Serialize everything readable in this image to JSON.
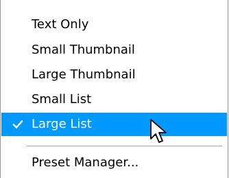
{
  "menu": {
    "items": [
      {
        "label": "Text Only",
        "checked": false
      },
      {
        "label": "Small Thumbnail",
        "checked": false
      },
      {
        "label": "Large Thumbnail",
        "checked": false
      },
      {
        "label": "Small List",
        "checked": false
      },
      {
        "label": "Large List",
        "checked": true,
        "highlighted": true
      }
    ],
    "after_separator": [
      {
        "label": "Preset Manager..."
      }
    ]
  },
  "icons": {
    "check": "checkmark-icon",
    "cursor": "mouse-pointer-icon"
  },
  "colors": {
    "highlight": "#0099ff",
    "highlight_text": "#ffffff",
    "text": "#000000",
    "border": "#979797"
  }
}
